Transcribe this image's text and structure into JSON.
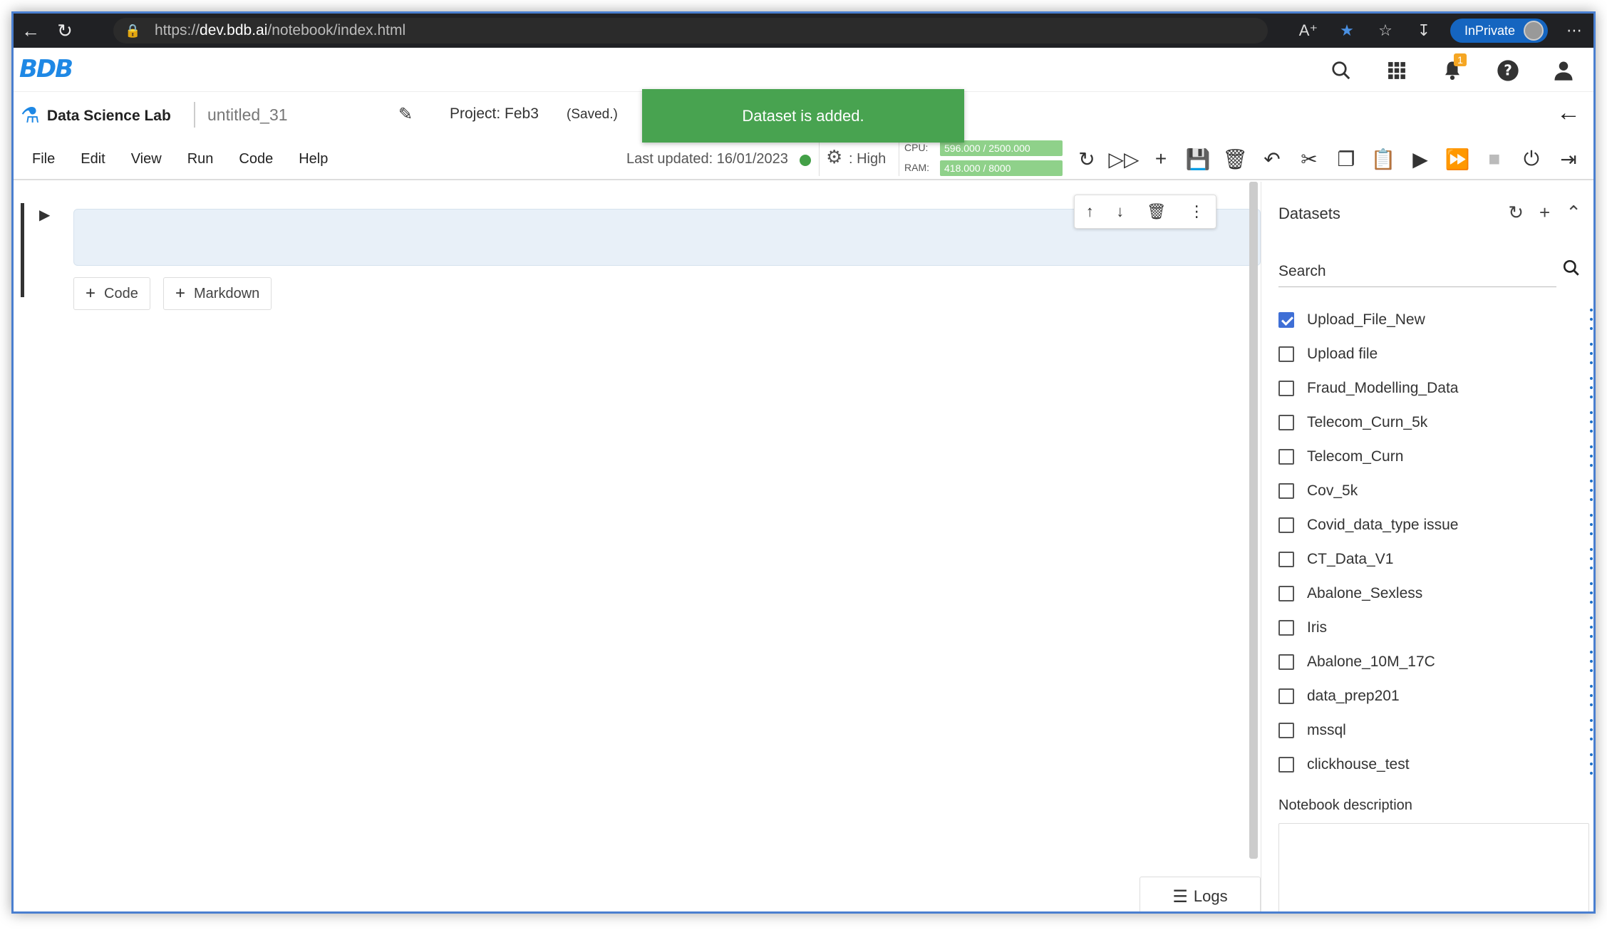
{
  "browser": {
    "url_prefix": "https://",
    "url_host": "dev.bdb.ai",
    "url_path": "/notebook/index.html",
    "inprivate_label": "InPrivate"
  },
  "app": {
    "logo_text": "BDB"
  },
  "header": {
    "notification_count": "1"
  },
  "notebook": {
    "app_name": "Data Science Lab",
    "name": "untitled_31",
    "project": "Project: Feb3",
    "save_status": "(Saved.)",
    "toast": "Dataset is added."
  },
  "menu": [
    "File",
    "Edit",
    "View",
    "Run",
    "Code",
    "Help"
  ],
  "status": {
    "last_updated": "Last updated: 16/01/2023",
    "kernel": ": High",
    "cpu_label": "CPU:",
    "cpu_value": "596.000 / 2500.000",
    "cpu_fraction": 0.24,
    "ram_label": "RAM:",
    "ram_value": "418.000 / 8000",
    "ram_fraction": 0.05
  },
  "cell_actions": {
    "add_code": "Code",
    "add_markdown": "Markdown",
    "logs": "Logs"
  },
  "datasets_panel": {
    "title": "Datasets",
    "search_placeholder": "Search",
    "items": [
      {
        "label": "Upload_File_New",
        "checked": true
      },
      {
        "label": "Upload file",
        "checked": false
      },
      {
        "label": "Fraud_Modelling_Data",
        "checked": false
      },
      {
        "label": "Telecom_Curn_5k",
        "checked": false
      },
      {
        "label": "Telecom_Curn",
        "checked": false
      },
      {
        "label": "Cov_5k",
        "checked": false
      },
      {
        "label": "Covid_data_type issue",
        "checked": false
      },
      {
        "label": "CT_Data_V1",
        "checked": false
      },
      {
        "label": "Abalone_Sexless",
        "checked": false
      },
      {
        "label": "Iris",
        "checked": false
      },
      {
        "label": "Abalone_10M_17C",
        "checked": false
      },
      {
        "label": "data_prep201",
        "checked": false
      },
      {
        "label": "mssql",
        "checked": false
      },
      {
        "label": "clickhouse_test",
        "checked": false
      }
    ],
    "description_label": "Notebook description"
  },
  "colors": {
    "toast": "#48a350",
    "accent": "#1e88e5",
    "checkbox": "#3f6fd6"
  }
}
